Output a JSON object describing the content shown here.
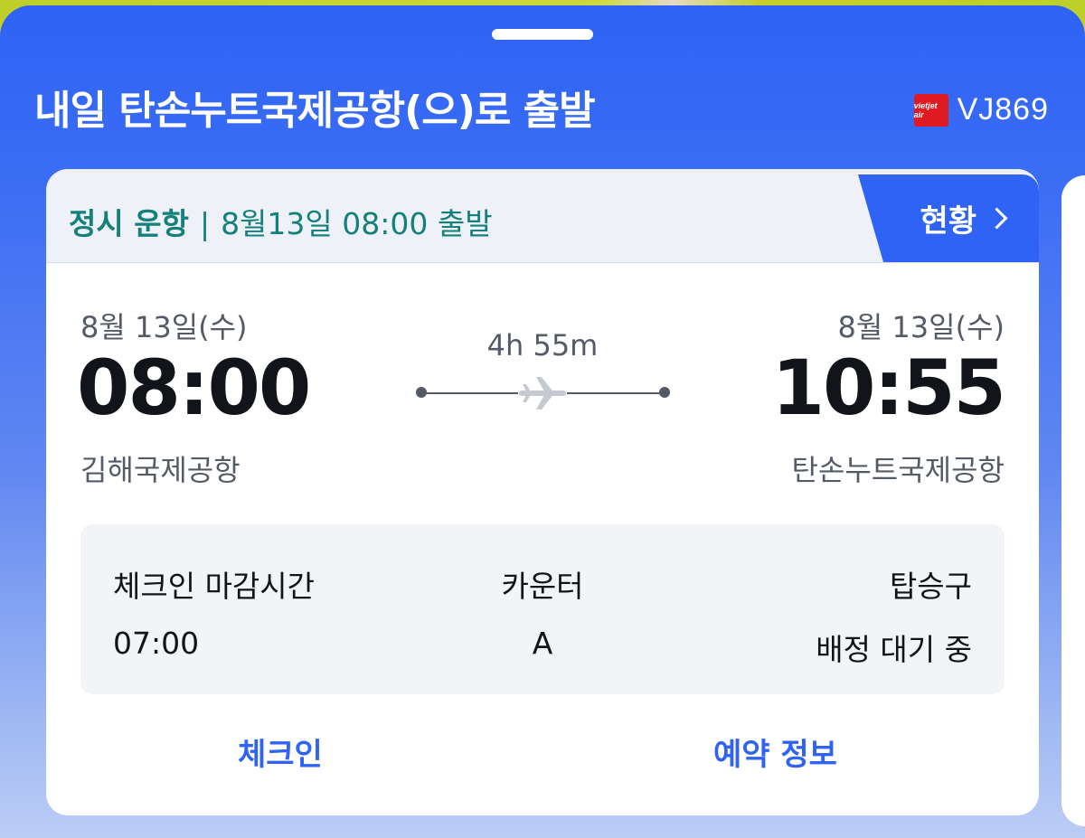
{
  "header": {
    "title": "내일 탄손누트국제공항(으)로 출발",
    "airline_logo_text": "vietjet air",
    "flight_number": "VJ869"
  },
  "status_bar": {
    "status": "정시 운항",
    "separator": "|",
    "departure_info": "8월13일 08:00 출발",
    "status_button_label": "현황"
  },
  "flight": {
    "departure": {
      "date": "8월 13일(수)",
      "time": "08:00",
      "airport": "김해국제공항"
    },
    "duration": "4h 55m",
    "arrival": {
      "date": "8월 13일(수)",
      "time": "10:55",
      "airport": "탄손누트국제공항"
    }
  },
  "info": {
    "checkin_deadline_label": "체크인 마감시간",
    "checkin_deadline_value": "07:00",
    "counter_label": "카운터",
    "counter_value": "A",
    "gate_label": "탑승구",
    "gate_value": "배정 대기 중"
  },
  "actions": {
    "checkin": "체크인",
    "booking_info": "예약 정보"
  },
  "colors": {
    "primary_blue": "#2e63f5",
    "status_teal": "#14807a",
    "airline_red": "#e01a22"
  }
}
